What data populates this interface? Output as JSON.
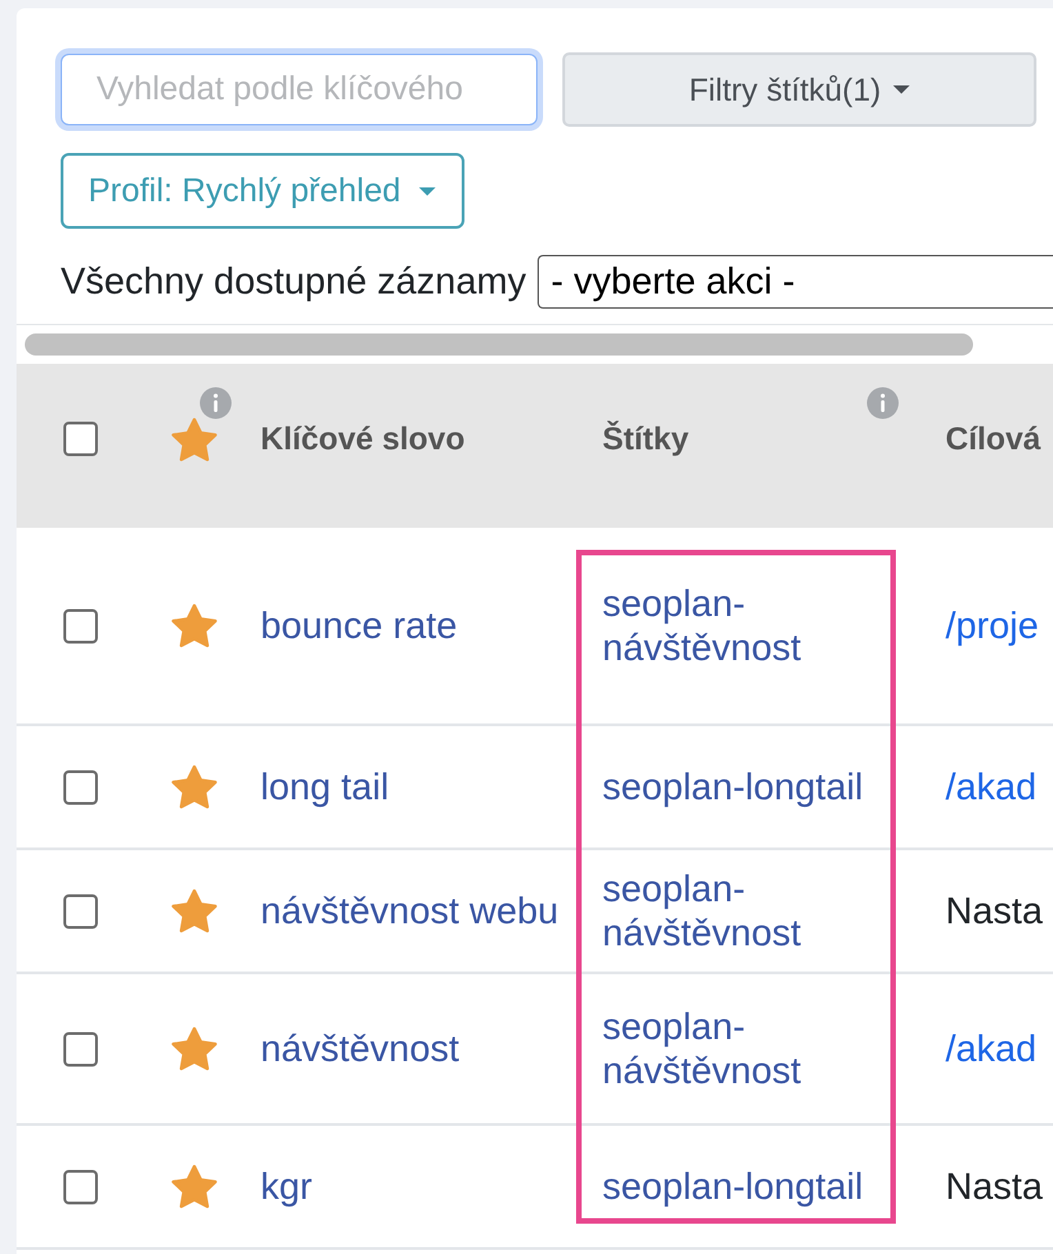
{
  "search": {
    "placeholder": "Vyhledat podle klíčového",
    "focused": true
  },
  "filter_button": {
    "label": "Filtry štítků(1)"
  },
  "profile_button": {
    "label": "Profil: Rychlý přehled"
  },
  "bulk_action": {
    "label": "Všechny dostupné záznamy",
    "value": "- vyberte akci -"
  },
  "table": {
    "columns": [
      {
        "kind": "checkbox",
        "checked": false,
        "info": false,
        "highlighted": false
      },
      {
        "kind": "star",
        "info": true,
        "highlighted": false
      },
      {
        "kind": "text",
        "label": "Klíčové slovo",
        "info": false,
        "highlighted": false
      },
      {
        "kind": "text",
        "label": "Štítky",
        "info": true,
        "highlighted": true
      },
      {
        "kind": "text",
        "label": "Cílová",
        "info": false,
        "highlighted": false
      }
    ],
    "rows": [
      {
        "cells": [
          {
            "kind": "checkbox",
            "checked": false
          },
          {
            "kind": "star",
            "starred": true
          },
          {
            "kind": "keyword",
            "text": "bounce rate"
          },
          {
            "kind": "tag",
            "text": "seoplan-návštěvnost"
          },
          {
            "kind": "link",
            "text": "/proje"
          }
        ]
      },
      {
        "cells": [
          {
            "kind": "checkbox",
            "checked": false
          },
          {
            "kind": "star",
            "starred": true
          },
          {
            "kind": "keyword",
            "text": "long tail"
          },
          {
            "kind": "tag",
            "text": "seoplan-longtail"
          },
          {
            "kind": "link",
            "text": "/akad"
          }
        ]
      },
      {
        "cells": [
          {
            "kind": "checkbox",
            "checked": false
          },
          {
            "kind": "star",
            "starred": true
          },
          {
            "kind": "keyword",
            "text": "návštěvnost webu"
          },
          {
            "kind": "tag",
            "text": "seoplan-návštěvnost"
          },
          {
            "kind": "text",
            "text": "Nasta"
          }
        ]
      },
      {
        "cells": [
          {
            "kind": "checkbox",
            "checked": false
          },
          {
            "kind": "star",
            "starred": true
          },
          {
            "kind": "keyword",
            "text": "návštěvnost"
          },
          {
            "kind": "tag",
            "text": "seoplan-návštěvnost"
          },
          {
            "kind": "link",
            "text": "/akad"
          }
        ]
      },
      {
        "cells": [
          {
            "kind": "checkbox",
            "checked": false
          },
          {
            "kind": "star",
            "starred": true
          },
          {
            "kind": "keyword",
            "text": "kgr"
          },
          {
            "kind": "tag",
            "text": "seoplan-longtail"
          },
          {
            "kind": "text",
            "text": "Nasta"
          }
        ]
      }
    ]
  }
}
